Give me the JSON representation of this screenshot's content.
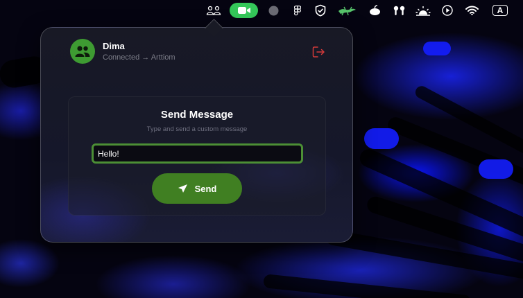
{
  "menubar": {
    "icons": [
      "people-icon",
      "facetime-video-icon",
      "record-dot-icon",
      "figma-icon",
      "shield-check-icon",
      "lizard-icon",
      "coconut-icon",
      "airpods-icon",
      "sunrise-icon",
      "play-icon",
      "wifi-icon"
    ],
    "input_source_label": "A",
    "facetime_color": "#34c759"
  },
  "popover": {
    "user": {
      "name": "Dima",
      "status": "Connected → Arttiom",
      "avatar_icon": "people-icon",
      "avatar_color": "#3e9b32"
    },
    "logout_icon": "logout-icon",
    "logout_color": "#d53a3a",
    "card": {
      "title": "Send Message",
      "subtitle": "Type and send a custom message",
      "input_value": "Hello!",
      "send_label": "Send",
      "send_icon": "paper-plane-icon",
      "accent": "#407f22",
      "input_border": "#4c8f35"
    }
  }
}
